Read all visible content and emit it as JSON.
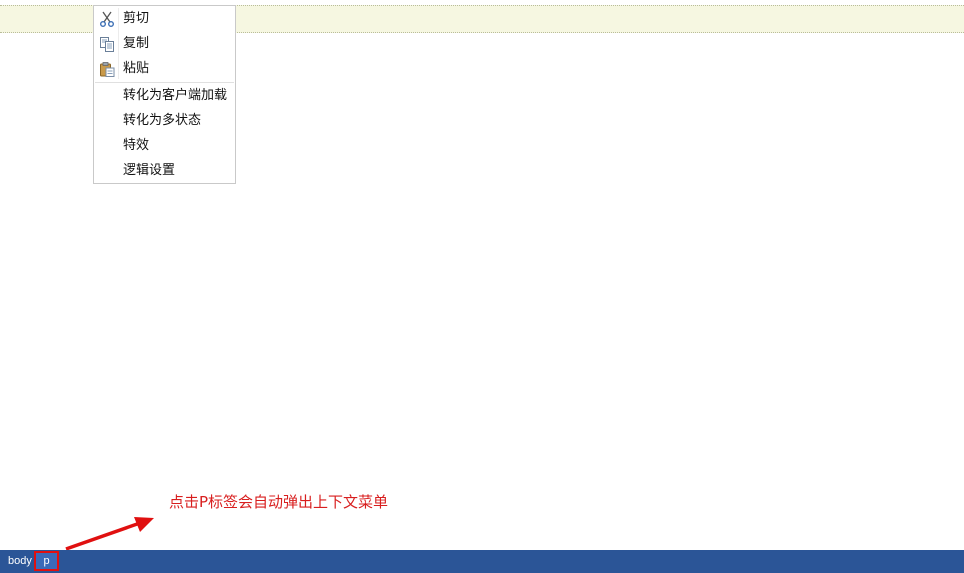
{
  "context_menu": {
    "items": [
      {
        "label": "剪切",
        "icon": "scissors-icon"
      },
      {
        "label": "复制",
        "icon": "copy-icon"
      },
      {
        "label": "粘贴",
        "icon": "paste-icon"
      },
      {
        "label": "转化为客户端加载"
      },
      {
        "label": "转化为多状态"
      },
      {
        "label": "特效"
      },
      {
        "label": "逻辑设置"
      }
    ]
  },
  "annotation": {
    "text": "点击P标签会自动弹出上下文菜单",
    "color": "#d81e1e"
  },
  "statusbar": {
    "path": [
      "body",
      "p"
    ],
    "background": "#2b5597"
  }
}
